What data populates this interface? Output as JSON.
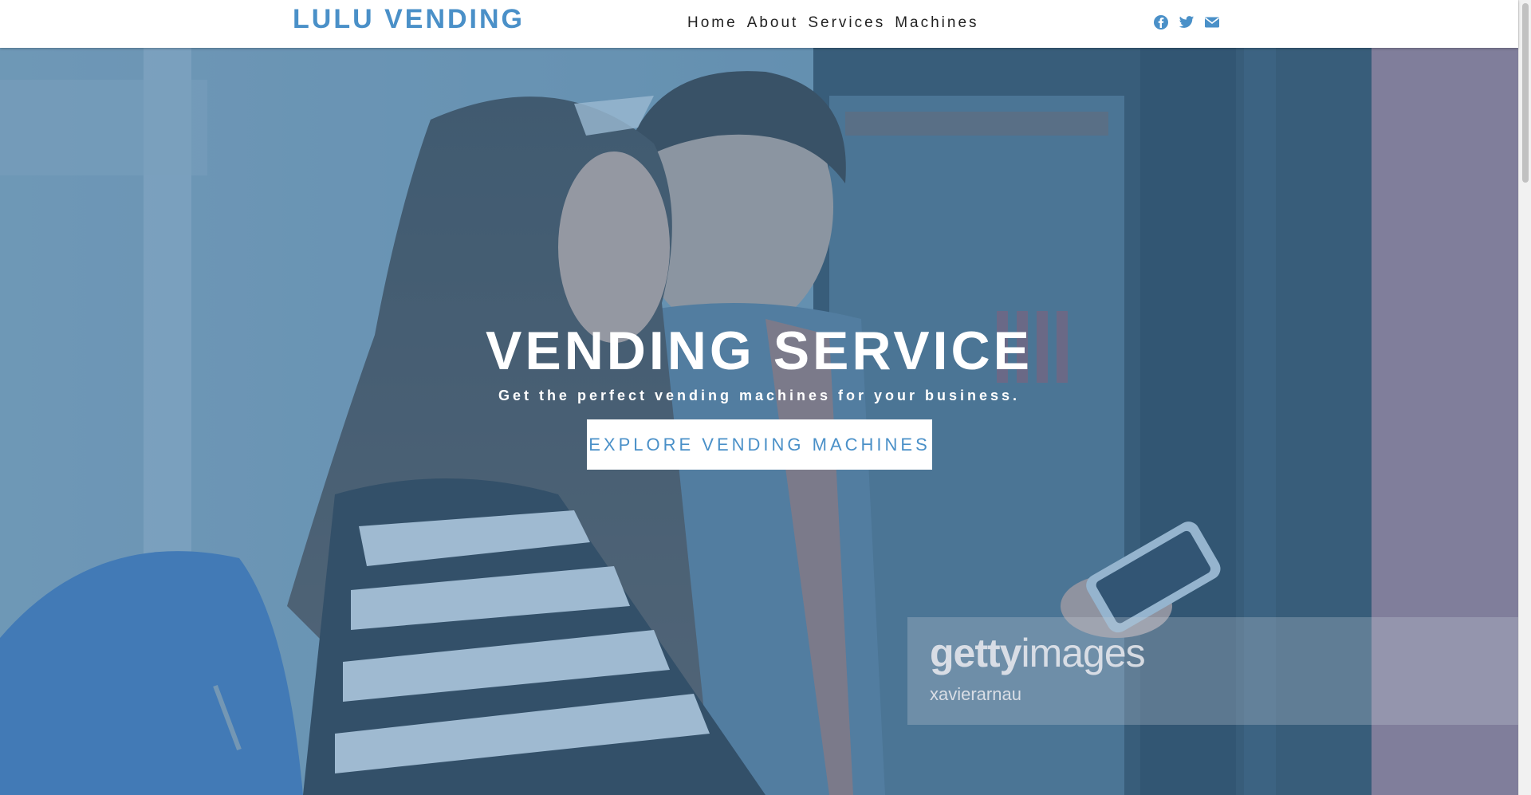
{
  "brand": {
    "logo_text": "LULU VENDING",
    "accent_color": "#4a90c8"
  },
  "nav": {
    "links": [
      "Home",
      "About",
      "Services",
      "Machines"
    ]
  },
  "social": {
    "icons": [
      "facebook-icon",
      "twitter-icon",
      "envelope-icon"
    ]
  },
  "hero": {
    "title": "VENDING SERVICE",
    "subtitle": "Get the perfect vending machines for your business.",
    "button_label": "EXPLORE VENDING MACHINES",
    "overlay_color": "#4682b4"
  },
  "watermark": {
    "brand_bold": "getty",
    "brand_light": "images",
    "credit": "xavierarnau"
  }
}
